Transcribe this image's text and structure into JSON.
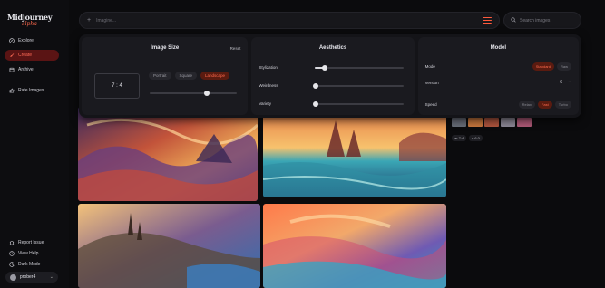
{
  "app": {
    "logo_main": "Midjourney",
    "logo_sub": "alpha",
    "accent": "#ff5a3c"
  },
  "sidebar": {
    "items": [
      {
        "label": "Explore",
        "icon": "compass-icon",
        "active": false
      },
      {
        "label": "Create",
        "icon": "brush-icon",
        "active": true
      },
      {
        "label": "Archive",
        "icon": "archive-icon",
        "active": false
      },
      {
        "label": "Rate Images",
        "icon": "thumbs-icon",
        "active": false
      }
    ],
    "bottom_items": [
      {
        "label": "Report Issue",
        "icon": "bug-icon"
      },
      {
        "label": "View Help",
        "icon": "help-icon"
      },
      {
        "label": "Dark Mode",
        "icon": "moon-icon"
      }
    ],
    "user": {
      "name": "prober4"
    }
  },
  "prompt": {
    "placeholder": "Imagine..."
  },
  "search": {
    "placeholder": "Search images"
  },
  "settings": {
    "image_size": {
      "title": "Image Size",
      "reset": "Reset",
      "ratio": "7 : 4",
      "options": [
        "Portrait",
        "Square",
        "Landscape"
      ],
      "selected": "Landscape",
      "ratio_slider_value": 0.66
    },
    "aesthetics": {
      "title": "Aesthetics",
      "rows": [
        {
          "label": "Stylization",
          "value": 0.1
        },
        {
          "label": "Weirdness",
          "value": 0.0
        },
        {
          "label": "Variety",
          "value": 0.0
        }
      ]
    },
    "model": {
      "title": "Model",
      "mode_label": "Mode",
      "mode_options": [
        "Standard",
        "Raw"
      ],
      "mode_selected": "Standard",
      "version_label": "Version",
      "version_value": "6",
      "speed_label": "Speed",
      "speed_options": [
        "Relax",
        "Fast",
        "Turbo"
      ],
      "speed_selected": "Fast"
    }
  },
  "gallery": {
    "chips": [
      "ar 7:4",
      "v 6.0"
    ]
  }
}
